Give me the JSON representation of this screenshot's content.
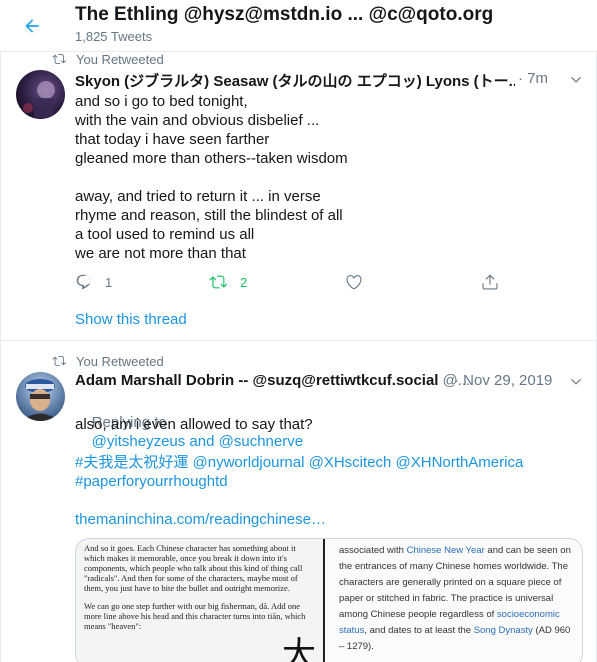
{
  "header": {
    "title": "The Ethling @hysz@mstdn.io ... @c@qoto.org",
    "subtitle": "1,825 Tweets"
  },
  "tweets": [
    {
      "retweet_label": "You Retweeted",
      "display_name": "Skyon (ジブラルタ) Seasaw (タルの山の エプコッ) Lyons (トー...",
      "time": "· 7m",
      "body": "and so i go to bed tonight,\nwith the vain and obvious disbelief ...\nthat today i have seen farther\ngleaned more than others--taken wisdom\n\naway, and tried to return it ... in verse\nrhyme and reason, still the blindest of all\na tool used to remind us all\nwe are not more than that",
      "reply_count": "1",
      "retweet_count": "2",
      "show_thread": "Show this thread"
    },
    {
      "retweet_label": "You Retweeted",
      "display_name": "Adam Marshall Dobrin -- @suzq@rettiwtkcuf.social",
      "handle": "@...",
      "time": "· Nov 29, 2019",
      "replying_prefix": "Replying to",
      "replying_to": "@yitsheyzeus and @suchnerve",
      "body": "also, am i even allowed to say that?",
      "hashtags_line1": "#夫我是太祝好運 @nyworldjournal @XHscitech @XHNorthAmerica",
      "hashtags_line2": "#paperforyourrhoughtd",
      "link": "themaninchina.com/readingchinese…",
      "card": {
        "left_p1": "And so it goes. Each Chinese character has something about it which makes it memorable, once you break it down into it's components, which people who talk about this kind of thing call \"radicals\". And then for some of the characters, maybe most of them, you just have to bite the bullet and outright memorize.",
        "left_p2": "We can go one step further with our big fisherman, dà. Add one more line above his head and this character turns into tiān, which means \"heaven\":",
        "big_char": "大",
        "right_text_a": "associated with ",
        "right_link_a": "Chinese New Year",
        "right_text_b": " and can be seen on the entrances of many Chinese homes worldwide. The characters are generally printed on a square piece of paper or stitched in fabric. The practice is universal among Chinese people regardless of ",
        "right_link_b": "socioeconomic status",
        "right_text_c": ", and dates to at least the ",
        "right_link_c": "Song Dynasty",
        "right_text_d": " (AD 960 – 1279)."
      }
    }
  ],
  "colors": {
    "accent": "#1b95e0",
    "retweet_green": "#17bf63",
    "muted": "#657786",
    "divider": "#e6ecf0"
  },
  "icons": [
    "back-arrow-icon",
    "retweet-icon",
    "reply-icon",
    "like-icon",
    "share-icon",
    "chevron-down-icon"
  ]
}
